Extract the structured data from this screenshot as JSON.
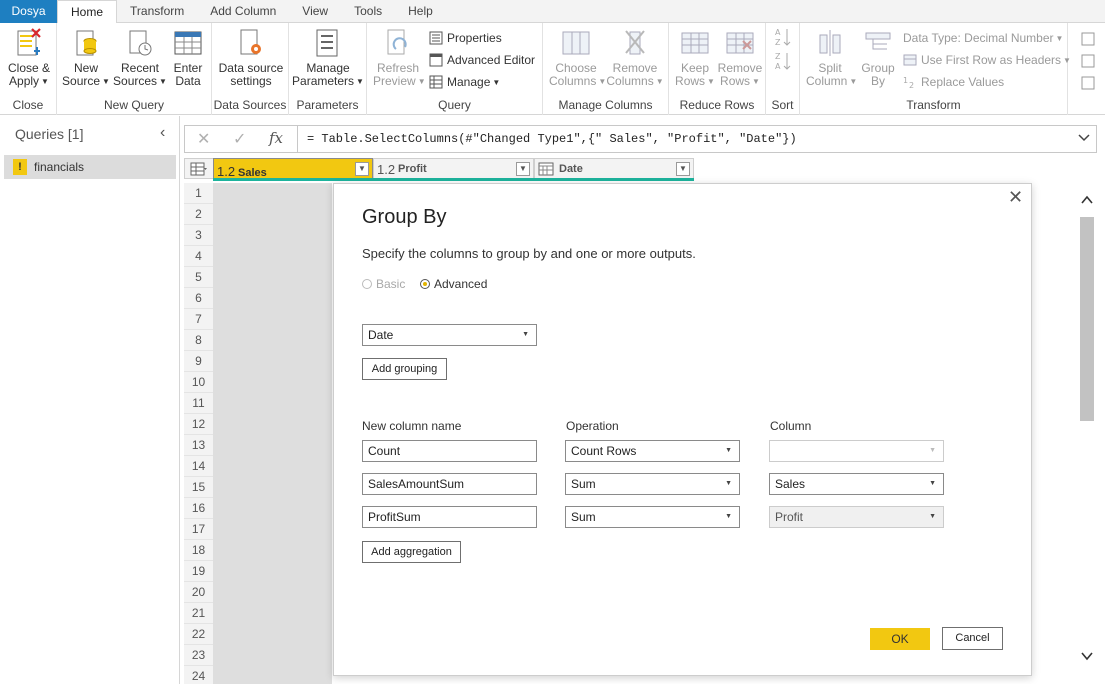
{
  "tabs": [
    "Dosya",
    "Home",
    "Transform",
    "Add Column",
    "View",
    "Tools",
    "Help"
  ],
  "ribbon": {
    "close_group": {
      "label": "Close",
      "close_apply": "Close &",
      "close_apply2": "Apply"
    },
    "new_query_group": {
      "label": "New Query",
      "new_source": "New",
      "new_source2": "Source",
      "recent_sources": "Recent",
      "recent_sources2": "Sources",
      "enter_data": "Enter",
      "enter_data2": "Data"
    },
    "data_sources_group": {
      "label": "Data Sources",
      "settings": "Data source",
      "settings2": "settings"
    },
    "parameters_group": {
      "label": "Parameters",
      "manage": "Manage",
      "manage2": "Parameters"
    },
    "query_group": {
      "label": "Query",
      "refresh": "Refresh",
      "refresh2": "Preview",
      "properties": "Properties",
      "advanced_editor": "Advanced Editor",
      "manage": "Manage"
    },
    "manage_columns_group": {
      "label": "Manage Columns",
      "choose": "Choose",
      "choose2": "Columns",
      "remove": "Remove",
      "remove2": "Columns"
    },
    "reduce_rows_group": {
      "label": "Reduce Rows",
      "keep": "Keep",
      "keep2": "Rows",
      "remove": "Remove",
      "remove2": "Rows"
    },
    "sort_group": {
      "label": "Sort"
    },
    "transform_group": {
      "label": "Transform",
      "split": "Split",
      "split2": "Column",
      "group_by": "Group",
      "group_by2": "By",
      "data_type": "Data Type: Decimal Number",
      "first_row": "Use First Row as Headers",
      "replace": "Replace Values"
    }
  },
  "queries": {
    "title": "Queries [1]",
    "items": [
      {
        "name": "financials",
        "warning": "!"
      }
    ]
  },
  "formula": {
    "text": "= Table.SelectColumns(#\"Changed Type1\",{\" Sales\", \"Profit\", \"Date\"})"
  },
  "columns": [
    {
      "type": "1.2",
      "name": "Sales"
    },
    {
      "type": "1.2",
      "name": "Profit"
    },
    {
      "type": "",
      "name": "Date"
    }
  ],
  "row_numbers": [
    "1",
    "2",
    "3",
    "4",
    "5",
    "6",
    "7",
    "8",
    "9",
    "10",
    "11",
    "12",
    "13",
    "14",
    "15",
    "16",
    "17",
    "18",
    "19",
    "20",
    "21",
    "22",
    "23",
    "24"
  ],
  "dialog": {
    "title": "Group By",
    "description": "Specify the columns to group by and one or more outputs.",
    "radio_basic": "Basic",
    "radio_advanced": "Advanced",
    "selected_mode": "Advanced",
    "grouping_column": "Date",
    "add_grouping": "Add grouping",
    "headers": {
      "new_column_name": "New column name",
      "operation": "Operation",
      "column": "Column"
    },
    "aggregations": [
      {
        "name": "Count",
        "operation": "Count Rows",
        "column": ""
      },
      {
        "name": "SalesAmountSum",
        "operation": "Sum",
        "column": "Sales"
      },
      {
        "name": "ProfitSum",
        "operation": "Sum",
        "column": "Profit"
      }
    ],
    "add_aggregation": "Add aggregation",
    "ok": "OK",
    "cancel": "Cancel"
  },
  "colors": {
    "accent_yellow": "#f2c811",
    "file_tab_blue": "#1e7fc1",
    "column_quality_teal": "#1db39c"
  }
}
